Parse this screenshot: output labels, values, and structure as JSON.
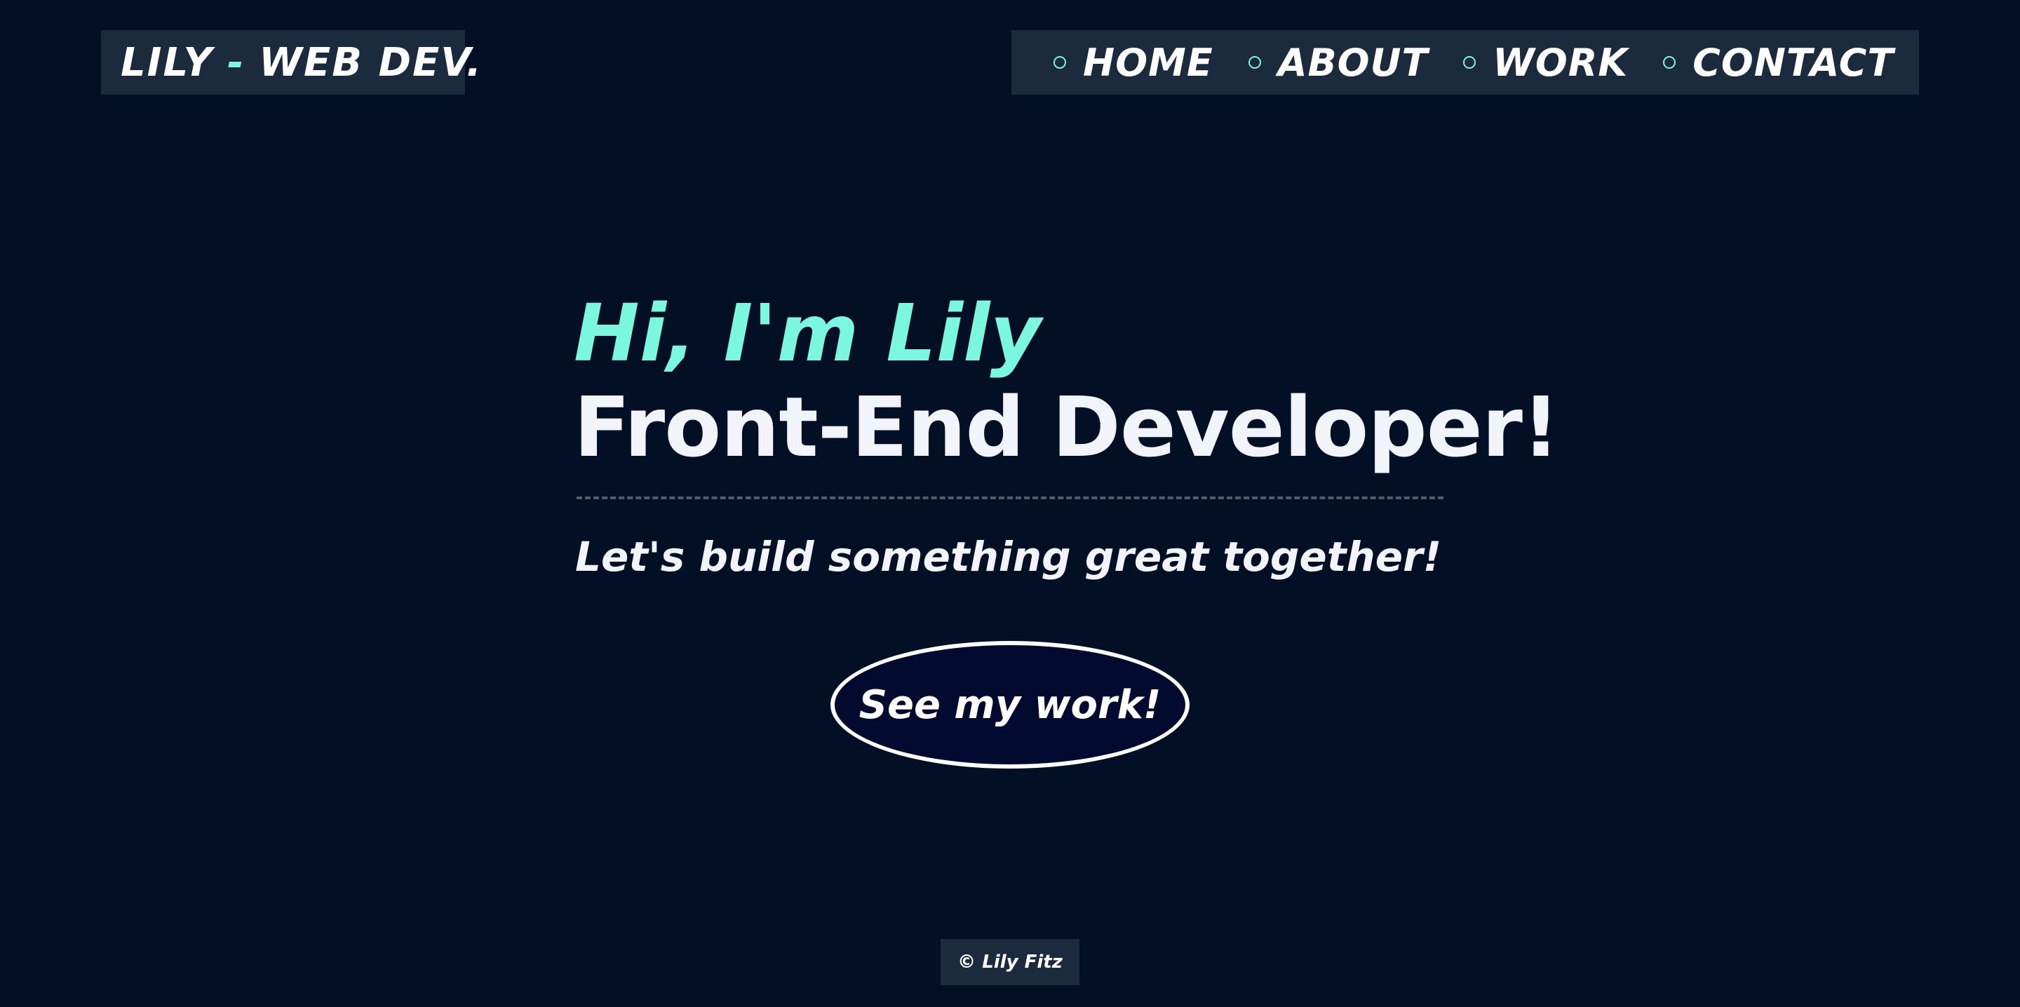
{
  "header": {
    "logo": {
      "name": "LILY",
      "dash": "-",
      "suffix": "WEB DEV."
    },
    "nav": [
      {
        "label": "HOME"
      },
      {
        "label": "ABOUT"
      },
      {
        "label": "WORK"
      },
      {
        "label": "CONTACT"
      }
    ]
  },
  "hero": {
    "greeting": "Hi, I'm Lily",
    "title": "Front-End Developer!",
    "subtitle": "Let's build something great together!",
    "cta_label": "See my work!"
  },
  "footer": {
    "text": "© Lily Fitz"
  },
  "colors": {
    "background": "#020f24",
    "panel": "#1b2a3c",
    "accent": "#7cf7df",
    "text": "#f2f4fb",
    "button_fill": "#030a30"
  },
  "icons": {
    "nav_bullet": "circle-outline-icon"
  }
}
